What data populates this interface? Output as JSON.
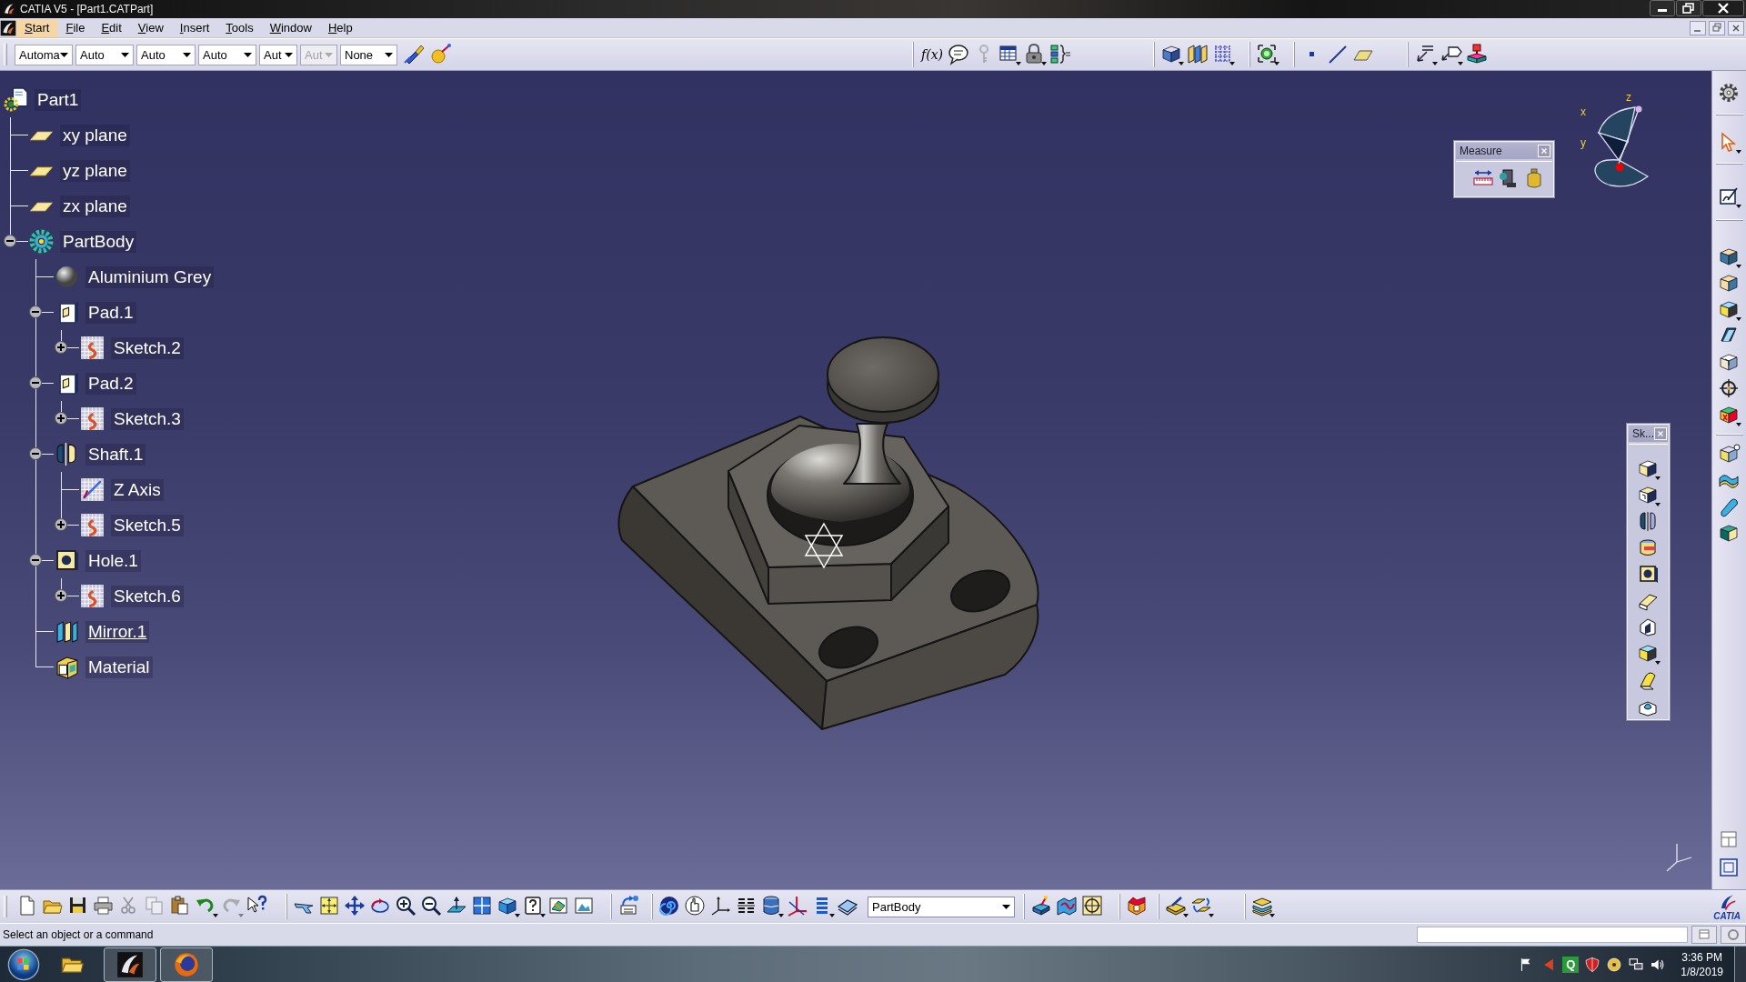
{
  "window": {
    "title": "CATIA V5 - [Part1.CATPart]"
  },
  "menu": [
    {
      "label": "Start",
      "selected": true
    },
    {
      "label": "File",
      "selected": false
    },
    {
      "label": "Edit",
      "selected": false
    },
    {
      "label": "View",
      "selected": false
    },
    {
      "label": "Insert",
      "selected": false
    },
    {
      "label": "Tools",
      "selected": false
    },
    {
      "label": "Window",
      "selected": false
    },
    {
      "label": "Help",
      "selected": false
    }
  ],
  "toolbar": {
    "dropdowns": [
      {
        "value": "Automa",
        "disabled": false
      },
      {
        "value": "Auto",
        "disabled": false
      },
      {
        "value": "Auto",
        "disabled": false
      },
      {
        "value": "Auto",
        "disabled": false
      },
      {
        "value": "Aut",
        "disabled": false
      },
      {
        "value": "Aut",
        "disabled": true
      },
      {
        "value": "None",
        "disabled": false
      }
    ],
    "knowledge_buttons": [
      {
        "label": "f(x)",
        "disabled": false
      },
      {
        "disabled": false
      },
      {
        "disabled": true
      },
      {
        "disabled": false
      },
      {
        "disabled": false
      },
      {
        "disabled": false
      }
    ]
  },
  "tree": {
    "label": "Part1",
    "kind": "part",
    "current": false,
    "children": [
      {
        "label": "xy plane",
        "kind": "plane",
        "current": false
      },
      {
        "label": "yz plane",
        "kind": "plane",
        "current": false
      },
      {
        "label": "zx plane",
        "kind": "plane",
        "current": false
      },
      {
        "label": "PartBody",
        "kind": "body",
        "current": false,
        "expanded": true,
        "children": [
          {
            "label": "Aluminium Grey",
            "kind": "material",
            "current": false
          },
          {
            "label": "Pad.1",
            "kind": "pad",
            "current": false,
            "expanded": true,
            "children": [
              {
                "label": "Sketch.2",
                "kind": "sketch",
                "current": false,
                "expanded": false
              }
            ]
          },
          {
            "label": "Pad.2",
            "kind": "pad",
            "current": false,
            "expanded": true,
            "children": [
              {
                "label": "Sketch.3",
                "kind": "sketch",
                "current": false,
                "expanded": false
              }
            ]
          },
          {
            "label": "Shaft.1",
            "kind": "shaft",
            "current": false,
            "expanded": true,
            "children": [
              {
                "label": "Z Axis",
                "kind": "axis",
                "current": false
              },
              {
                "label": "Sketch.5",
                "kind": "sketch",
                "current": false,
                "expanded": false
              }
            ]
          },
          {
            "label": "Hole.1",
            "kind": "hole",
            "current": false,
            "expanded": true,
            "children": [
              {
                "label": "Sketch.6",
                "kind": "sketch",
                "current": false,
                "expanded": false
              }
            ]
          },
          {
            "label": "Mirror.1",
            "kind": "mirror",
            "current": true
          },
          {
            "label": "Material",
            "kind": "catalog",
            "current": false
          }
        ]
      }
    ]
  },
  "measure_toolbar": {
    "title": "Measure"
  },
  "compass": {
    "x_label": "x",
    "y_label": "y",
    "z_label": "z"
  },
  "sketch_toolbar": {
    "title": "Sk..."
  },
  "standard_toolbar": {
    "edit_buttons": [
      {
        "disabled": false
      },
      {
        "disabled": false
      },
      {
        "disabled": false
      },
      {
        "disabled": false
      },
      {
        "disabled": true
      },
      {
        "disabled": true
      },
      {
        "disabled": false
      },
      {
        "disabled": false
      },
      {
        "disabled": true
      },
      {
        "disabled": false
      }
    ],
    "body_selector": {
      "value": "PartBody"
    },
    "logo": "CATIA"
  },
  "status_bar": {
    "message": "Select an object or a command"
  },
  "taskbar": {
    "apps": [
      {
        "running": false
      },
      {
        "running": true
      },
      {
        "running": true
      }
    ],
    "tray_badge": "Q",
    "time": "3:36 PM",
    "date": "1/8/2019"
  }
}
